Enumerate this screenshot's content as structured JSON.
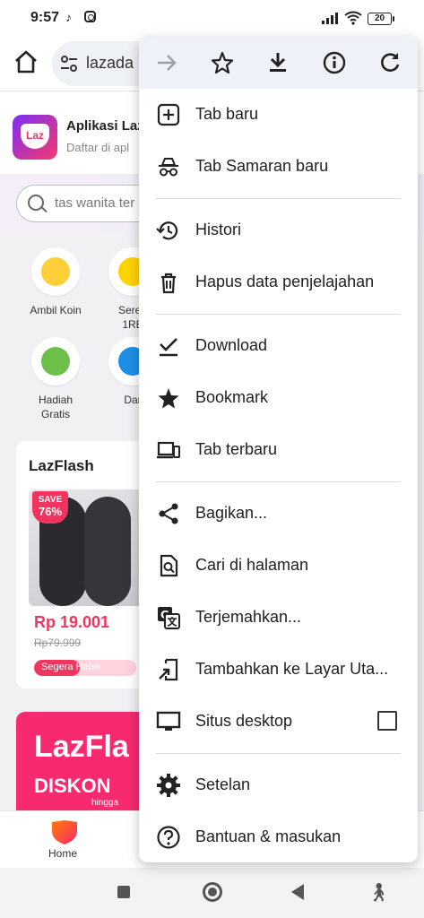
{
  "status_bar": {
    "time": "9:57",
    "battery": "20"
  },
  "browser": {
    "url": "lazada"
  },
  "page": {
    "app_banner": {
      "title": "Aplikasi Laz",
      "subtitle": "Daftar di apl",
      "logo_text": "Laz"
    },
    "search_placeholder": "tas wanita ter",
    "grid": [
      {
        "label": "Ambil Koin"
      },
      {
        "label": "Seren\n1RE"
      },
      {
        "label": "Hadiah\nGratis"
      },
      {
        "label": "Dar"
      }
    ],
    "flash": {
      "title": "LazFlash",
      "save_label": "SAVE",
      "save_pct": "76%",
      "price": "Rp 19.001",
      "old_price": "Rp79.999",
      "stock_label": "Segera Habis",
      "stock_fill_pct": 45
    },
    "promo": {
      "line1": "LazFla",
      "line2": "DISKON",
      "line3": "hingga"
    },
    "bottom_nav": {
      "home": "Home"
    }
  },
  "menu": {
    "actions": [
      {
        "icon": "forward-arrow-icon"
      },
      {
        "icon": "star-icon"
      },
      {
        "icon": "download-icon"
      },
      {
        "icon": "info-icon"
      },
      {
        "icon": "refresh-icon"
      }
    ],
    "groups": [
      [
        {
          "label": "Tab baru",
          "icon": "new-tab-icon"
        },
        {
          "label": "Tab Samaran baru",
          "icon": "incognito-icon"
        }
      ],
      [
        {
          "label": "Histori",
          "icon": "history-icon"
        },
        {
          "label": "Hapus data penjelajahan",
          "icon": "trash-icon"
        }
      ],
      [
        {
          "label": "Download",
          "icon": "downloads-icon"
        },
        {
          "label": "Bookmark",
          "icon": "bookmark-star-icon"
        },
        {
          "label": "Tab terbaru",
          "icon": "devices-icon"
        }
      ],
      [
        {
          "label": "Bagikan...",
          "icon": "share-icon"
        },
        {
          "label": "Cari di halaman",
          "icon": "find-in-page-icon"
        },
        {
          "label": "Terjemahkan...",
          "icon": "translate-icon"
        },
        {
          "label": "Tambahkan ke Layar Uta...",
          "icon": "add-to-home-icon"
        },
        {
          "label": "Situs desktop",
          "icon": "desktop-icon",
          "checkbox": false
        }
      ],
      [
        {
          "label": "Setelan",
          "icon": "settings-gear-icon"
        },
        {
          "label": "Bantuan & masukan",
          "icon": "help-icon"
        }
      ]
    ]
  }
}
